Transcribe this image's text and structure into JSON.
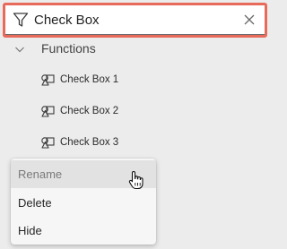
{
  "search": {
    "value": "Check Box",
    "filter_icon": "filter-icon",
    "clear_icon": "close-icon"
  },
  "tree": {
    "group": {
      "label": "Functions",
      "icon": "chevron-down-icon",
      "expanded": true
    },
    "items": [
      {
        "label": "Check Box 1",
        "icon": "shapes-icon"
      },
      {
        "label": "Check Box 2",
        "icon": "shapes-icon"
      },
      {
        "label": "Check Box 3",
        "icon": "shapes-icon"
      }
    ]
  },
  "context_menu": {
    "items": [
      {
        "label": "Rename",
        "hovered": true
      },
      {
        "label": "Delete",
        "hovered": false
      },
      {
        "label": "Hide",
        "hovered": false
      }
    ]
  },
  "colors": {
    "highlight": "#e86a5a",
    "background": "#ececec",
    "menu_background": "#f6f6f6",
    "menu_hover": "#e2e2e2"
  },
  "cursor": "hand-pointer-icon"
}
